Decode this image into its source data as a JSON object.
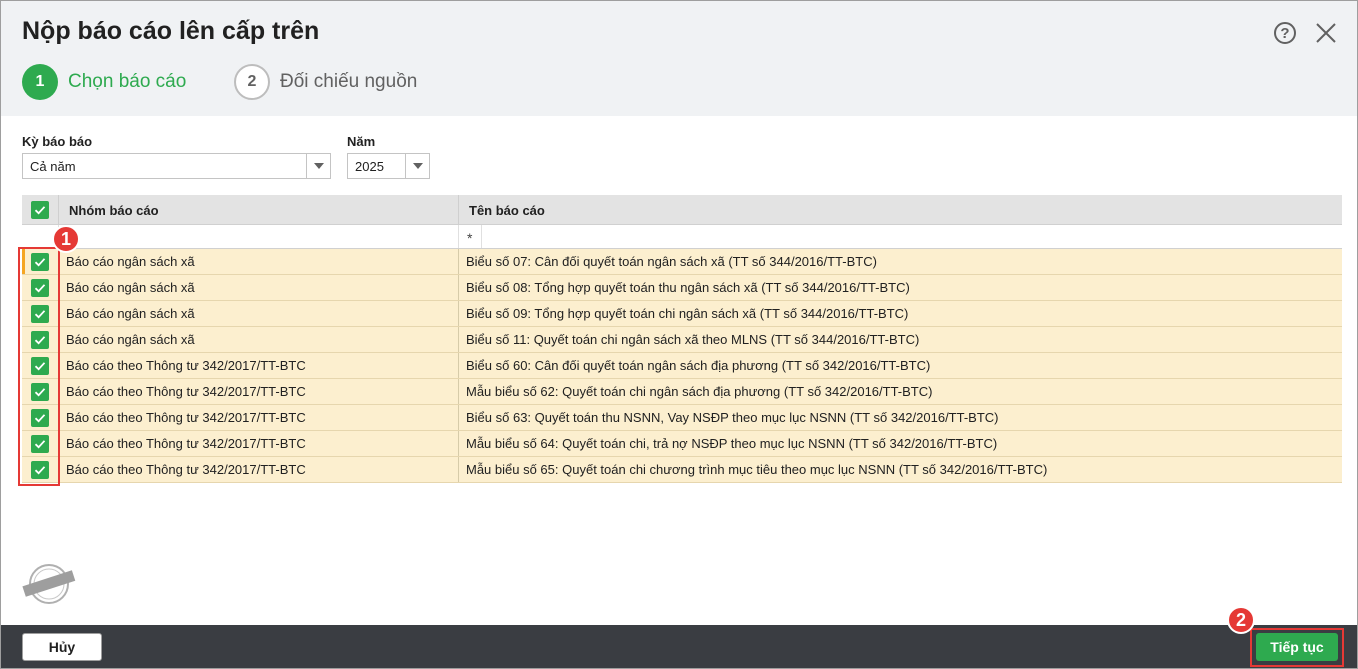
{
  "dialog": {
    "title": "Nộp báo cáo lên cấp trên",
    "help_icon": "help-circle-icon",
    "help_glyph": "?",
    "close_icon": "close-icon"
  },
  "steps": [
    {
      "number": "1",
      "label": "Chọn báo cáo",
      "state": "active"
    },
    {
      "number": "2",
      "label": "Đối chiếu nguồn",
      "state": "inactive"
    }
  ],
  "filters": {
    "period_label": "Kỳ báo báo",
    "period_value": "Cả năm",
    "year_label": "Năm",
    "year_value": "2025"
  },
  "grid": {
    "columns": [
      "Nhóm báo cáo",
      "Tên báo cáo"
    ],
    "filter_placeholder": "*",
    "select_all_checked": true,
    "rows": [
      {
        "checked": true,
        "group": "Báo cáo ngân sách xã",
        "name": "Biểu số 07: Cân đối quyết toán ngân sách xã (TT số 344/2016/TT-BTC)"
      },
      {
        "checked": true,
        "group": "Báo cáo ngân sách xã",
        "name": "Biểu số 08: Tổng hợp quyết toán thu ngân sách xã (TT số 344/2016/TT-BTC)"
      },
      {
        "checked": true,
        "group": "Báo cáo ngân sách xã",
        "name": "Biểu số 09: Tổng hợp quyết toán chi ngân sách xã (TT số 344/2016/TT-BTC)"
      },
      {
        "checked": true,
        "group": "Báo cáo ngân sách xã",
        "name": "Biểu số 11: Quyết toán chi ngân sách xã theo MLNS (TT số 344/2016/TT-BTC)"
      },
      {
        "checked": true,
        "group": "Báo cáo theo Thông tư 342/2017/TT-BTC",
        "name": "Biểu số 60: Cân đối quyết toán ngân sách địa phương (TT số 342/2016/TT-BTC)"
      },
      {
        "checked": true,
        "group": "Báo cáo theo Thông tư 342/2017/TT-BTC",
        "name": "Mẫu biểu số 62: Quyết toán chi ngân sách địa phương (TT số 342/2016/TT-BTC)"
      },
      {
        "checked": true,
        "group": "Báo cáo theo Thông tư 342/2017/TT-BTC",
        "name": "Biểu số 63: Quyết toán thu NSNN, Vay NSĐP theo mục lục NSNN (TT số 342/2016/TT-BTC)"
      },
      {
        "checked": true,
        "group": "Báo cáo theo Thông tư 342/2017/TT-BTC",
        "name": "Mẫu biểu số 64: Quyết toán chi, trả nợ NSĐP theo mục lục NSNN (TT số 342/2016/TT-BTC)"
      },
      {
        "checked": true,
        "group": "Báo cáo theo Thông tư 342/2017/TT-BTC",
        "name": "Mẫu biểu số 65: Quyết toán chi chương trình mục tiêu theo mục lục NSNN (TT số 342/2016/TT-BTC)"
      }
    ]
  },
  "callouts": [
    "1",
    "2"
  ],
  "watermark": {
    "text": "DỮ LIỆU MẪU",
    "icon": "sample-data-stamp-icon"
  },
  "footer": {
    "cancel_label": "Hủy",
    "next_label": "Tiếp tục"
  },
  "colors": {
    "accent": "#2eaa4f",
    "row_highlight": "#fcefcf",
    "footer_bg": "#3a3d42",
    "callout": "#e53935"
  }
}
